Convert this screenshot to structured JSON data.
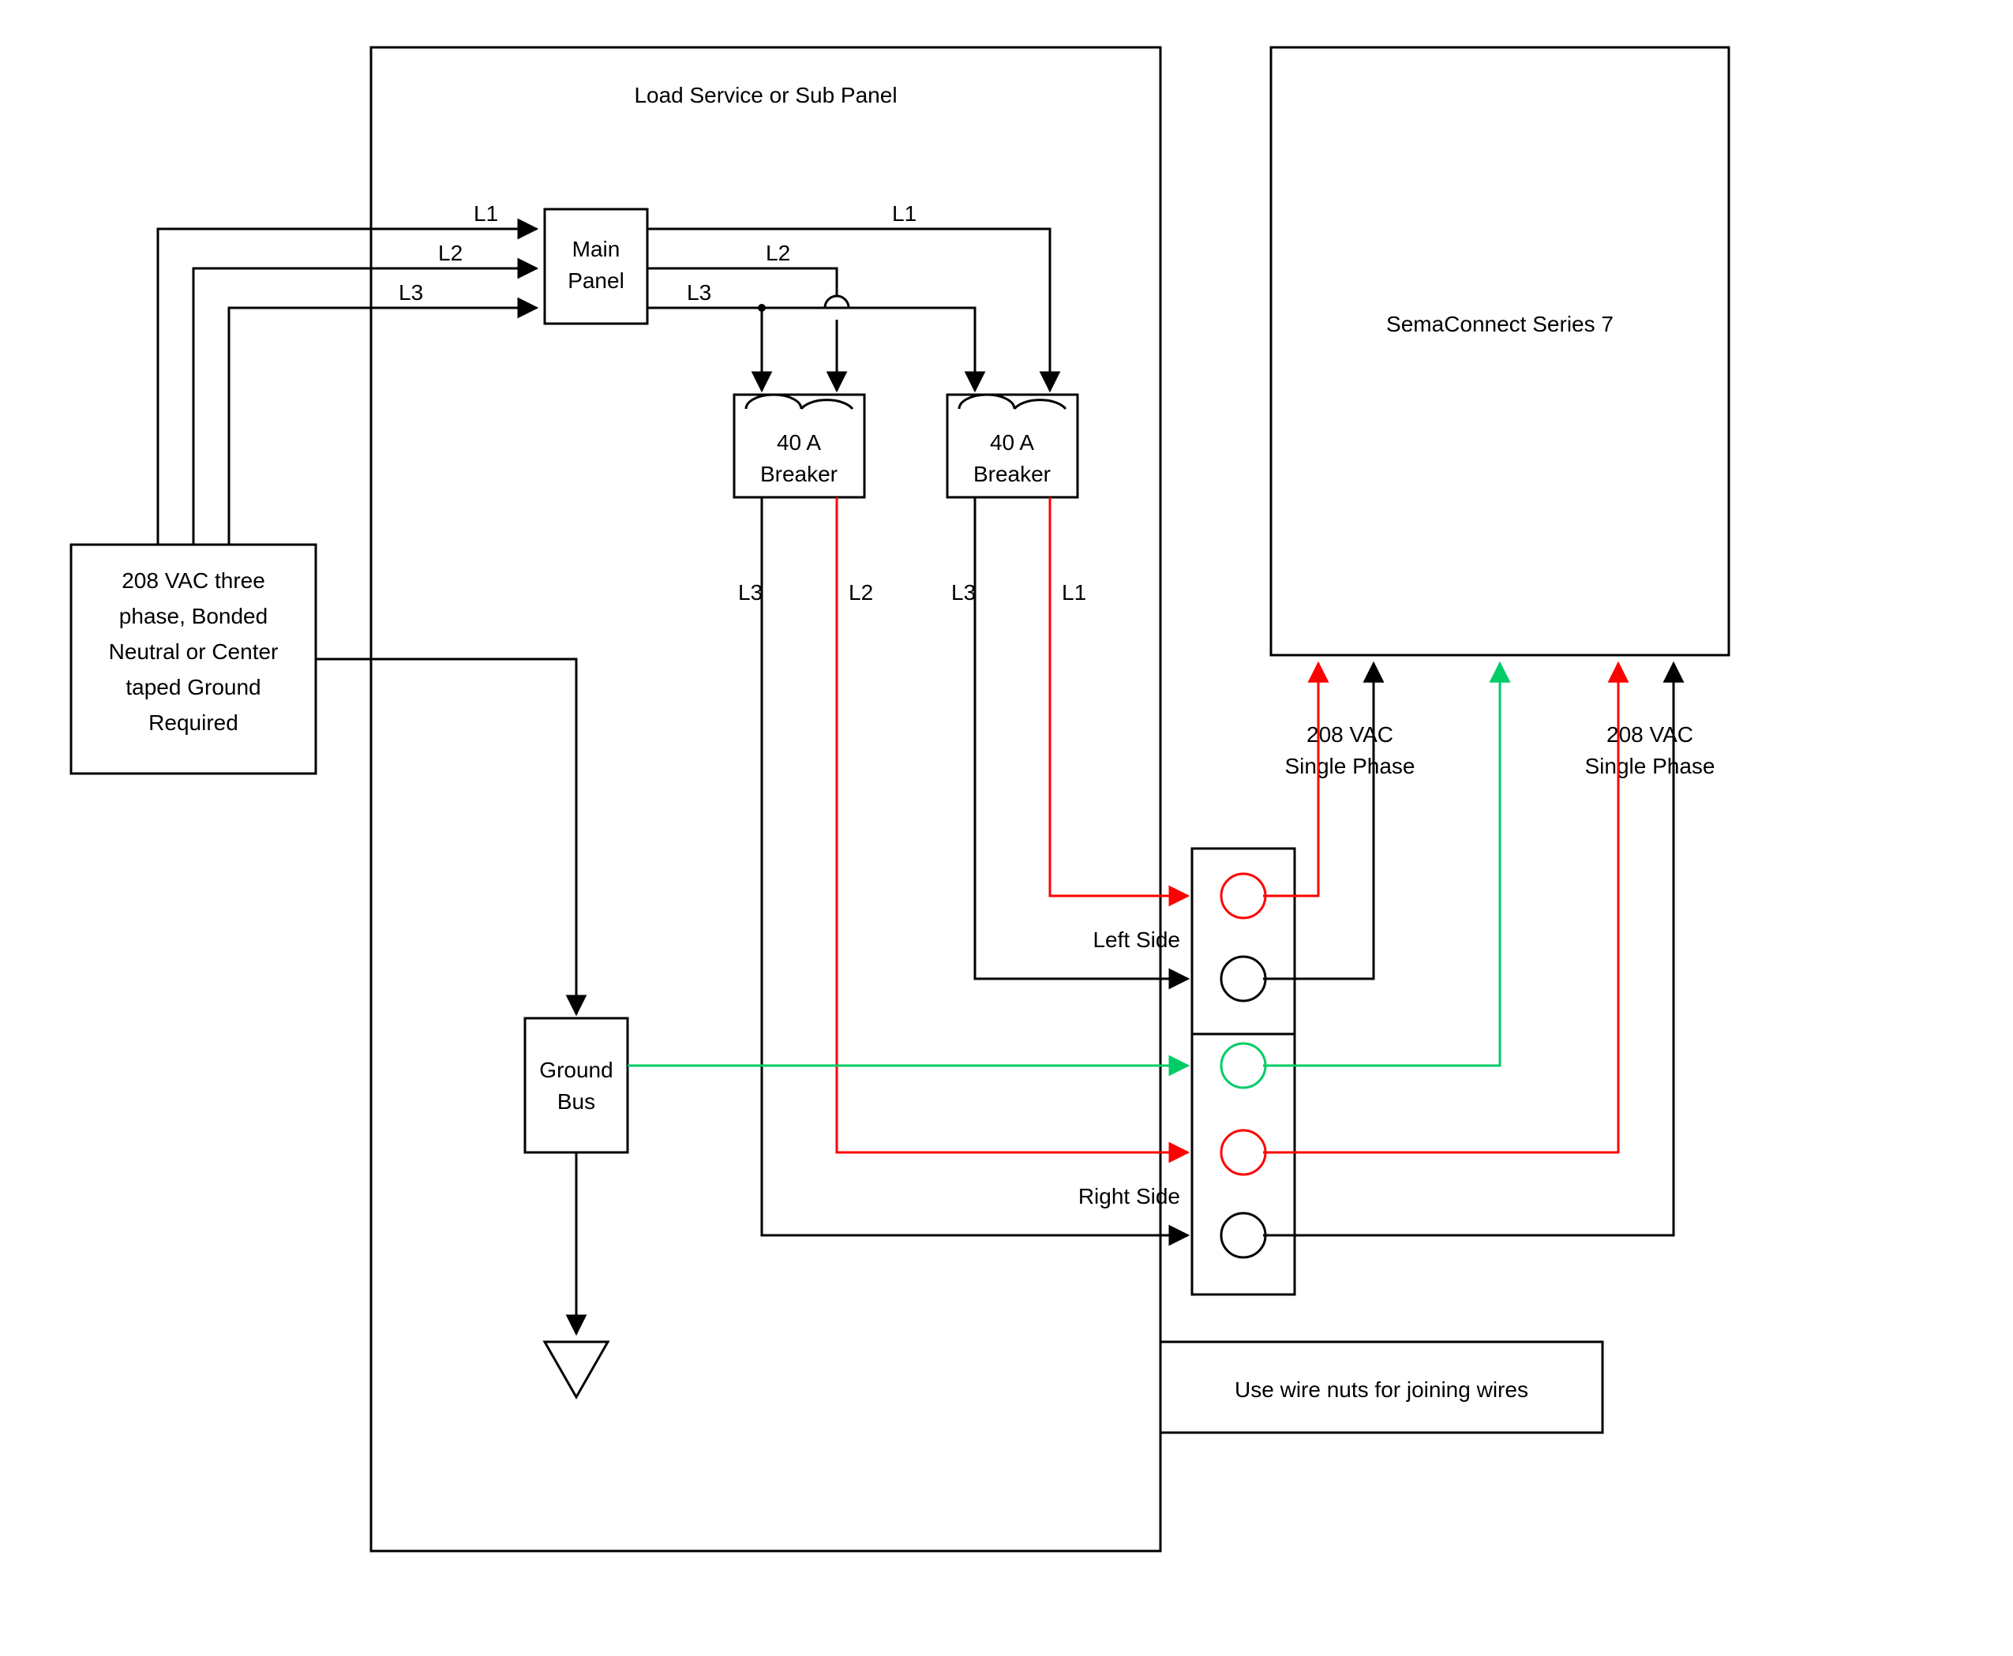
{
  "panel_title": "Load Service or Sub Panel",
  "source": {
    "l1": "208 VAC three",
    "l2": "phase, Bonded",
    "l3": "Neutral or Center",
    "l4": "taped Ground",
    "l5": "Required"
  },
  "lines": {
    "L1": "L1",
    "L2": "L2",
    "L3": "L3"
  },
  "main_panel": {
    "l1": "Main",
    "l2": "Panel"
  },
  "breaker": {
    "l1": "40 A",
    "l2": "Breaker"
  },
  "ground_bus": {
    "l1": "Ground",
    "l2": "Bus"
  },
  "left_side": "Left Side",
  "right_side": "Right Side",
  "sema": "SemaConnect Series 7",
  "phase": {
    "l1": "208 VAC",
    "l2": "Single Phase"
  },
  "wire_nuts": "Use wire nuts for joining wires"
}
